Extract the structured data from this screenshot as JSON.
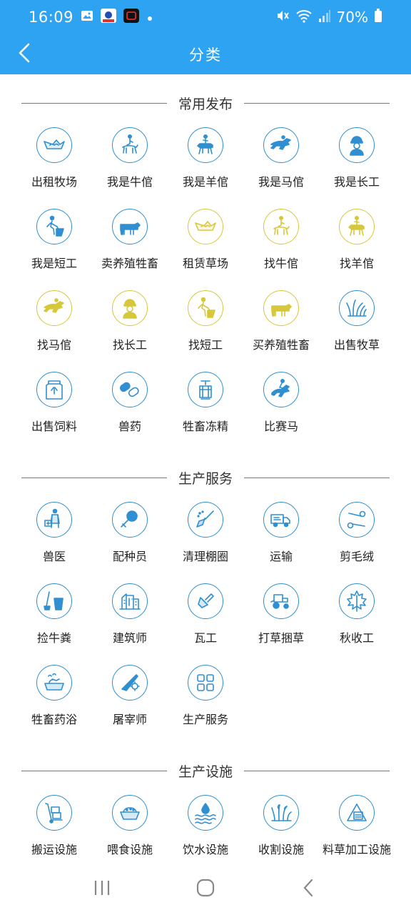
{
  "status_bar": {
    "time": "16:09",
    "battery": "70%",
    "icons": [
      "gallery-icon",
      "app-icon",
      "screen-record-icon",
      "dot-icon",
      "mute-icon",
      "wifi-icon",
      "signal-icon",
      "battery-icon"
    ]
  },
  "app_bar": {
    "title": "分类",
    "back_icon": "chevron-left-icon"
  },
  "colors": {
    "primary": "#2ea3f2",
    "icon_blue": "#2f8fd1",
    "icon_yellow": "#d6c83a"
  },
  "sections": [
    {
      "title": "常用发布",
      "items": [
        {
          "label": "出租牧场",
          "icon": "pasture-icon",
          "color": "blue"
        },
        {
          "label": "我是牛倌",
          "icon": "rider-icon",
          "color": "blue"
        },
        {
          "label": "我是羊倌",
          "icon": "horseback-icon",
          "color": "blue"
        },
        {
          "label": "我是马倌",
          "icon": "racehorse-icon",
          "color": "blue"
        },
        {
          "label": "我是长工",
          "icon": "worker-icon",
          "color": "blue"
        },
        {
          "label": "我是短工",
          "icon": "digger-icon",
          "color": "blue"
        },
        {
          "label": "卖养殖牲畜",
          "icon": "cow-icon",
          "color": "blue"
        },
        {
          "label": "租赁草场",
          "icon": "pasture-icon",
          "color": "yellow"
        },
        {
          "label": "找牛倌",
          "icon": "rider-icon",
          "color": "yellow"
        },
        {
          "label": "找羊倌",
          "icon": "horseback-icon",
          "color": "yellow"
        },
        {
          "label": "找马倌",
          "icon": "racehorse-icon",
          "color": "yellow"
        },
        {
          "label": "找长工",
          "icon": "worker-icon",
          "color": "yellow"
        },
        {
          "label": "找短工",
          "icon": "digger-icon",
          "color": "yellow"
        },
        {
          "label": "买养殖牲畜",
          "icon": "cow-icon",
          "color": "yellow"
        },
        {
          "label": "出售牧草",
          "icon": "grass-icon",
          "color": "blue"
        },
        {
          "label": "出售饲料",
          "icon": "feed-bag-icon",
          "color": "blue"
        },
        {
          "label": "兽药",
          "icon": "capsule-icon",
          "color": "blue"
        },
        {
          "label": "牲畜冻精",
          "icon": "tank-icon",
          "color": "blue"
        },
        {
          "label": "比赛马",
          "icon": "jockey-icon",
          "color": "blue"
        }
      ]
    },
    {
      "title": "生产服务",
      "items": [
        {
          "label": "兽医",
          "icon": "vet-icon",
          "color": "blue"
        },
        {
          "label": "配种员",
          "icon": "breeder-icon",
          "color": "blue"
        },
        {
          "label": "清理棚圈",
          "icon": "broom-icon",
          "color": "blue"
        },
        {
          "label": "运输",
          "icon": "truck-icon",
          "color": "blue"
        },
        {
          "label": "剪毛绒",
          "icon": "scissors-icon",
          "color": "blue"
        },
        {
          "label": "捡牛粪",
          "icon": "bucket-icon",
          "color": "blue"
        },
        {
          "label": "建筑师",
          "icon": "building-icon",
          "color": "blue"
        },
        {
          "label": "瓦工",
          "icon": "trowel-icon",
          "color": "blue"
        },
        {
          "label": "打草捆草",
          "icon": "tractor-icon",
          "color": "blue"
        },
        {
          "label": "秋收工",
          "icon": "leaf-icon",
          "color": "blue"
        },
        {
          "label": "牲畜药浴",
          "icon": "bath-icon",
          "color": "blue"
        },
        {
          "label": "屠宰师",
          "icon": "knife-icon",
          "color": "blue"
        },
        {
          "label": "生产服务",
          "icon": "grid-icon",
          "color": "blue"
        }
      ]
    },
    {
      "title": "生产设施",
      "items": [
        {
          "label": "搬运设施",
          "icon": "hand-truck-icon",
          "color": "blue"
        },
        {
          "label": "喂食设施",
          "icon": "feeder-icon",
          "color": "blue"
        },
        {
          "label": "饮水设施",
          "icon": "water-icon",
          "color": "blue"
        },
        {
          "label": "收割设施",
          "icon": "harvest-icon",
          "color": "blue"
        },
        {
          "label": "料草加工设施",
          "icon": "processing-icon",
          "color": "blue"
        }
      ]
    }
  ],
  "nav_bar": {
    "icons": [
      "recent-apps-icon",
      "home-icon",
      "back-icon"
    ]
  }
}
